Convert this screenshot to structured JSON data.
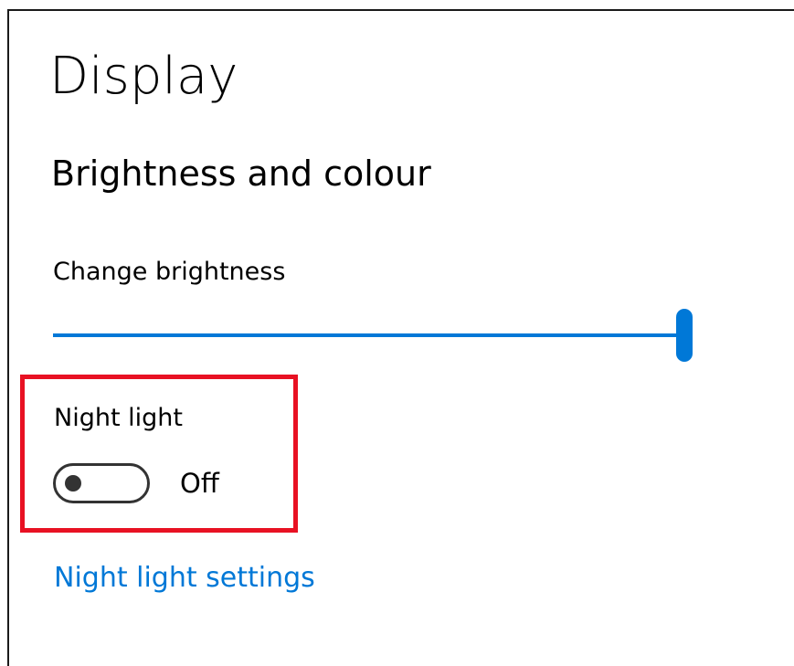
{
  "page": {
    "title": "Display"
  },
  "brightness_section": {
    "heading": "Brightness and colour",
    "slider_label": "Change brightness",
    "brightness_percent": 100
  },
  "night_light": {
    "label": "Night light",
    "toggle_on": false,
    "toggle_state_text": "Off",
    "settings_link": "Night light settings",
    "highlighted": true
  },
  "colors": {
    "accent": "#0078d7",
    "highlight": "#e81123",
    "text": "#000000",
    "background": "#ffffff"
  }
}
